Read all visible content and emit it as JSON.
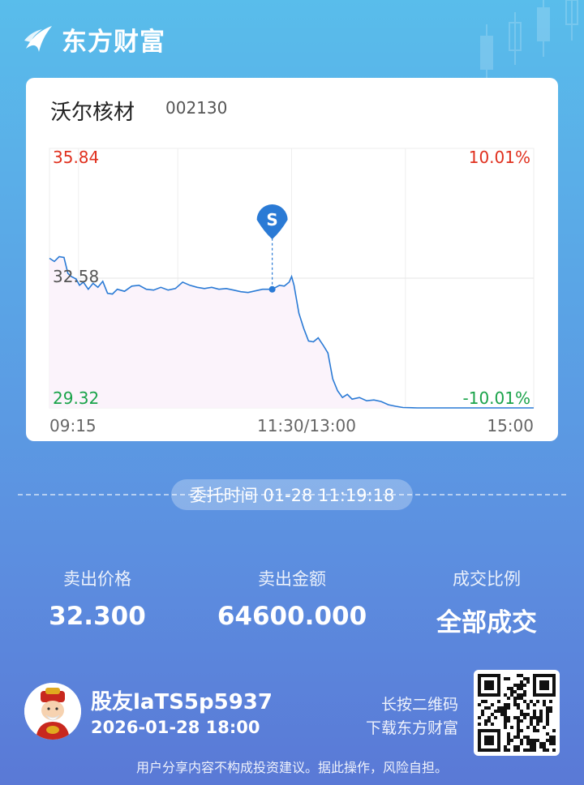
{
  "brand": {
    "name": "东方财富",
    "logo_icon": "eastmoney-logo-icon"
  },
  "stock": {
    "name": "沃尔核材",
    "code": "002130"
  },
  "chart_data": {
    "type": "line",
    "y_labels": {
      "top": "35.84",
      "mid": "32.58",
      "bottom": "29.32"
    },
    "pct_labels": {
      "top": "10.01%",
      "bottom": "-10.01%"
    },
    "x_labels": {
      "start": "09:15",
      "mid": "11:30/13:00",
      "end": "15:00"
    },
    "ylim": [
      29.32,
      35.84
    ],
    "prev_close": 32.58,
    "colors": {
      "line": "#2a7ad5",
      "up": "#e0301e",
      "down": "#1aa34a",
      "fill": "#fbf3fb"
    },
    "marker": {
      "label": "S",
      "time_fraction": 0.46,
      "price": 32.3
    },
    "series": [
      [
        0.0,
        33.08
      ],
      [
        0.01,
        33.0
      ],
      [
        0.02,
        33.12
      ],
      [
        0.03,
        33.1
      ],
      [
        0.038,
        32.7
      ],
      [
        0.045,
        32.62
      ],
      [
        0.055,
        32.56
      ],
      [
        0.062,
        32.4
      ],
      [
        0.07,
        32.48
      ],
      [
        0.08,
        32.3
      ],
      [
        0.09,
        32.45
      ],
      [
        0.1,
        32.35
      ],
      [
        0.11,
        32.5
      ],
      [
        0.12,
        32.2
      ],
      [
        0.13,
        32.18
      ],
      [
        0.14,
        32.3
      ],
      [
        0.155,
        32.25
      ],
      [
        0.17,
        32.38
      ],
      [
        0.185,
        32.4
      ],
      [
        0.2,
        32.3
      ],
      [
        0.215,
        32.28
      ],
      [
        0.23,
        32.35
      ],
      [
        0.245,
        32.28
      ],
      [
        0.26,
        32.32
      ],
      [
        0.275,
        32.48
      ],
      [
        0.29,
        32.4
      ],
      [
        0.305,
        32.35
      ],
      [
        0.32,
        32.32
      ],
      [
        0.335,
        32.35
      ],
      [
        0.35,
        32.3
      ],
      [
        0.365,
        32.32
      ],
      [
        0.38,
        32.28
      ],
      [
        0.395,
        32.24
      ],
      [
        0.41,
        32.22
      ],
      [
        0.425,
        32.26
      ],
      [
        0.44,
        32.3
      ],
      [
        0.46,
        32.3
      ],
      [
        0.475,
        32.4
      ],
      [
        0.485,
        32.38
      ],
      [
        0.495,
        32.48
      ],
      [
        0.5,
        32.62
      ],
      [
        0.505,
        32.4
      ],
      [
        0.515,
        31.7
      ],
      [
        0.525,
        31.32
      ],
      [
        0.535,
        31.0
      ],
      [
        0.545,
        30.98
      ],
      [
        0.555,
        31.08
      ],
      [
        0.565,
        30.9
      ],
      [
        0.575,
        30.7
      ],
      [
        0.585,
        30.05
      ],
      [
        0.595,
        29.75
      ],
      [
        0.605,
        29.58
      ],
      [
        0.615,
        29.66
      ],
      [
        0.625,
        29.54
      ],
      [
        0.64,
        29.58
      ],
      [
        0.655,
        29.5
      ],
      [
        0.67,
        29.52
      ],
      [
        0.685,
        29.48
      ],
      [
        0.7,
        29.4
      ],
      [
        0.715,
        29.36
      ],
      [
        0.73,
        29.33
      ],
      [
        0.76,
        29.32
      ],
      [
        0.8,
        29.32
      ],
      [
        0.85,
        29.32
      ],
      [
        0.9,
        29.32
      ],
      [
        0.95,
        29.32
      ],
      [
        1.0,
        29.32
      ]
    ]
  },
  "order": {
    "time_text": "委托时间 01-28 11:19:18"
  },
  "stats": [
    {
      "label": "卖出价格",
      "value": "32.300"
    },
    {
      "label": "卖出金额",
      "value": "64600.000"
    },
    {
      "label": "成交比例",
      "value": "全部成交"
    }
  ],
  "user": {
    "name": "股友laTS5p5937",
    "datetime": "2026-01-28 18:00",
    "avatar_icon": "fortune-god-avatar-icon"
  },
  "qr": {
    "hint_line1": "长按二维码",
    "hint_line2": "下载东方财富",
    "icon": "qr-code-icon"
  },
  "footer": {
    "disclaimer": "用户分享内容不构成投资建议。据此操作，风险自担。"
  }
}
